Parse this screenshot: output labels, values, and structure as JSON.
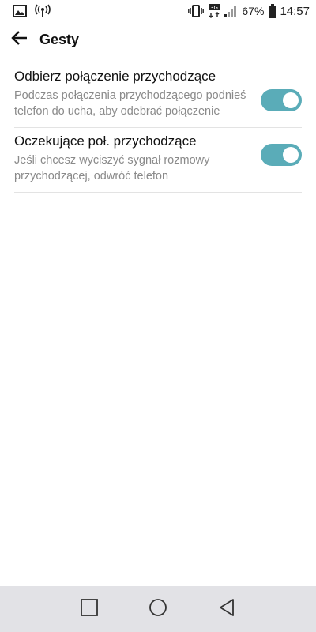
{
  "status_bar": {
    "left_icons": [
      "image-icon",
      "hotspot-icon"
    ],
    "right_icons": [
      "vibrate-icon",
      "network-3g-icon",
      "signal-icon",
      "battery-icon"
    ],
    "battery_percent": "67%",
    "time": "14:57"
  },
  "app_bar": {
    "back_icon": "arrow-left-icon",
    "title": "Gesty"
  },
  "settings": [
    {
      "title": "Odbierz połączenie przychodzące",
      "description": "Podczas połączenia przychodzącego podnieś telefon do ucha, aby odebrać połączenie",
      "enabled": true
    },
    {
      "title": "Oczekujące poł. przychodzące",
      "description": "Jeśli chcesz wyciszyć sygnał rozmowy przychodzącej, odwróć telefon",
      "enabled": true
    }
  ],
  "nav_bar": {
    "icons": [
      "recents-square-icon",
      "home-circle-icon",
      "back-triangle-icon"
    ]
  },
  "colors": {
    "toggle_on": "#5aacb8",
    "nav_background": "#e2e2e6",
    "description_text": "#8a8a8a"
  }
}
